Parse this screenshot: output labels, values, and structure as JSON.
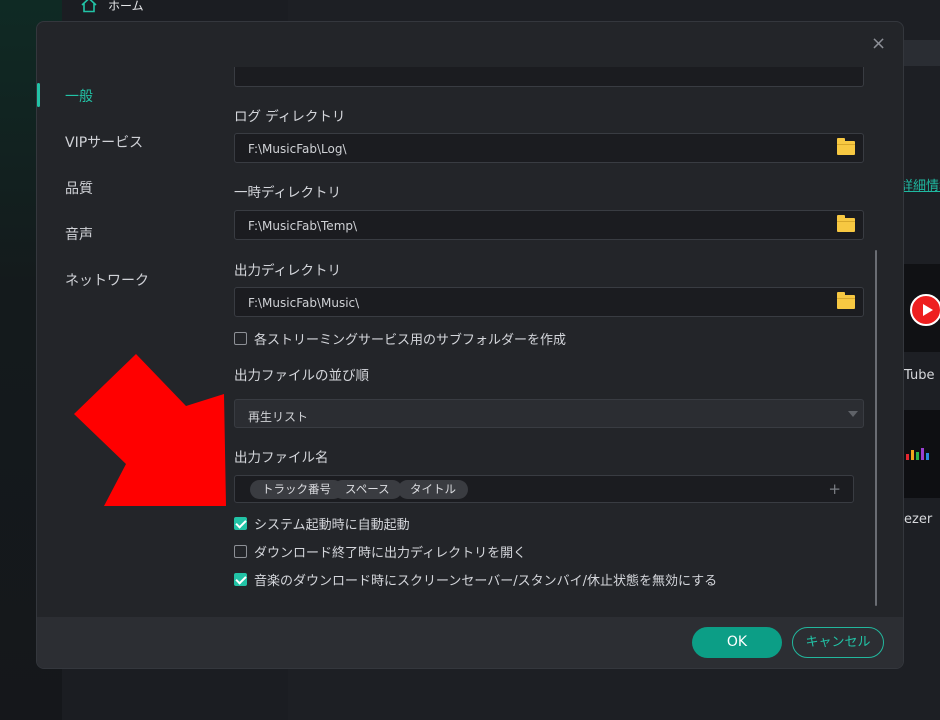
{
  "background": {
    "home_label": "ホーム",
    "link_text": "詳細情報",
    "card1_label": "Tube",
    "card2_label": "ezer"
  },
  "dialog": {
    "close_glyph": "×",
    "tabs": [
      {
        "label": "一般",
        "active": true
      },
      {
        "label": "VIPサービス",
        "active": false
      },
      {
        "label": "品質",
        "active": false
      },
      {
        "label": "音声",
        "active": false
      },
      {
        "label": "ネットワーク",
        "active": false
      }
    ],
    "log_dir": {
      "label": "ログ ディレクトリ",
      "value": "F:\\MusicFab\\Log\\"
    },
    "temp_dir": {
      "label": "一時ディレクトリ",
      "value": "F:\\MusicFab\\Temp\\"
    },
    "output_dir": {
      "label": "出力ディレクトリ",
      "value": "F:\\MusicFab\\Music\\"
    },
    "subfolder_option": {
      "label": "各ストリーミングサービス用のサブフォルダーを作成",
      "checked": false
    },
    "sort_order": {
      "label": "出力ファイルの並び順",
      "value": "再生リスト"
    },
    "output_filename": {
      "label": "出力ファイル名",
      "tags": [
        "トラック番号",
        "スペース",
        "タイトル"
      ],
      "add_glyph": "+"
    },
    "options": [
      {
        "label": "システム起動時に自動起動",
        "checked": true
      },
      {
        "label": "ダウンロード終了時に出力ディレクトリを開く",
        "checked": false
      },
      {
        "label": "音楽のダウンロード時にスクリーンセーバー/スタンバイ/休止状態を無効にする",
        "checked": true
      }
    ],
    "ok_label": "OK",
    "cancel_label": "キャンセル"
  },
  "colors": {
    "accent": "#22c3a6",
    "ok_button": "#0c9e86",
    "folder_icon": "#f7c842",
    "annotation_arrow": "#ff0000"
  }
}
